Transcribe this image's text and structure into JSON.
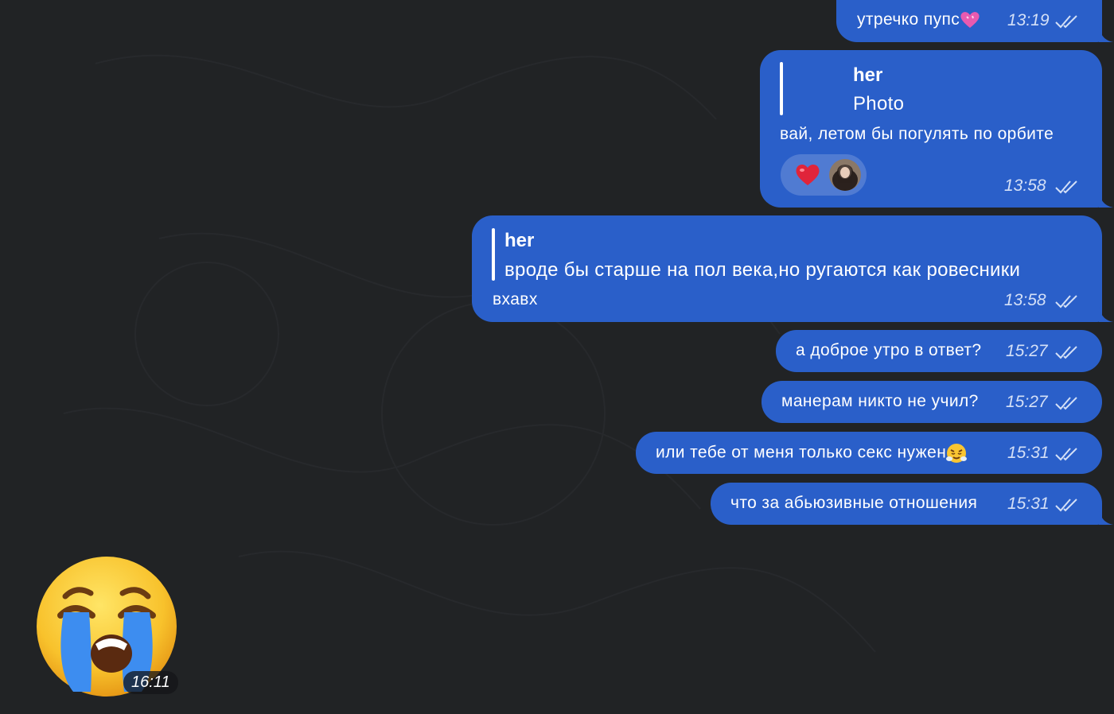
{
  "messages": [
    {
      "text": "утречко пупс",
      "emoji": "sparkling-heart",
      "time": "13:19"
    },
    {
      "reply": {
        "name": "her",
        "text": "Photo"
      },
      "text": "вай, летом бы погулять по орбите",
      "reaction": "red-heart",
      "time": "13:58"
    },
    {
      "reply": {
        "name": "her",
        "text": "вроде бы старше на пол века,но ругаются как ровесники"
      },
      "text": "вхавх",
      "time": "13:58"
    },
    {
      "text": "а доброе утро в ответ?",
      "time": "15:27"
    },
    {
      "text": "манерам никто не учил?",
      "time": "15:27"
    },
    {
      "text": "или тебе от меня только секс нужен",
      "emoji": "face-with-steam",
      "time": "15:31"
    },
    {
      "text": "что за абьюзивные отношения",
      "time": "15:31"
    }
  ],
  "sticker": {
    "emoji": "loudly-crying-face",
    "time": "16:11"
  },
  "colors": {
    "background": "#212325",
    "bubble": "#2a5fc9",
    "time": "#d4e0f7"
  }
}
